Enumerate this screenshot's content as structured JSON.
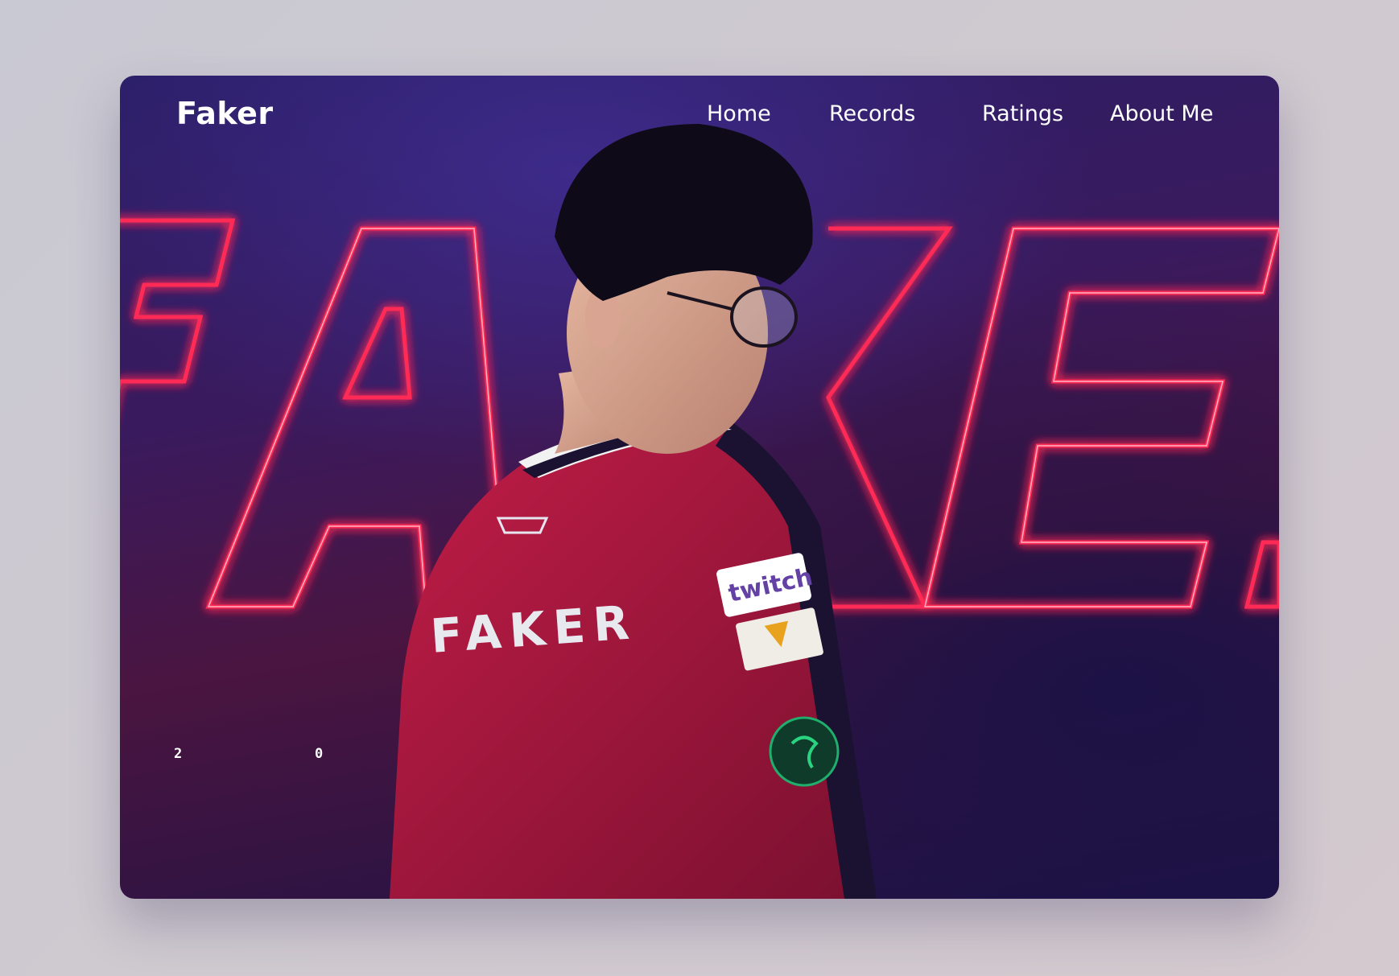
{
  "brand": {
    "logo": "Faker"
  },
  "nav": {
    "items": [
      {
        "label": "Home"
      },
      {
        "label": "Records"
      },
      {
        "label": "Ratings"
      },
      {
        "label": "About Me"
      }
    ]
  },
  "hero": {
    "neon_text": "FAKER",
    "jersey_name": "FAKER",
    "jersey_patch": "twitch",
    "year_digits": [
      "2",
      "0"
    ],
    "colors": {
      "neon": "#ff2a55",
      "jersey": "#a5173b",
      "background": "#2b1e66"
    }
  }
}
